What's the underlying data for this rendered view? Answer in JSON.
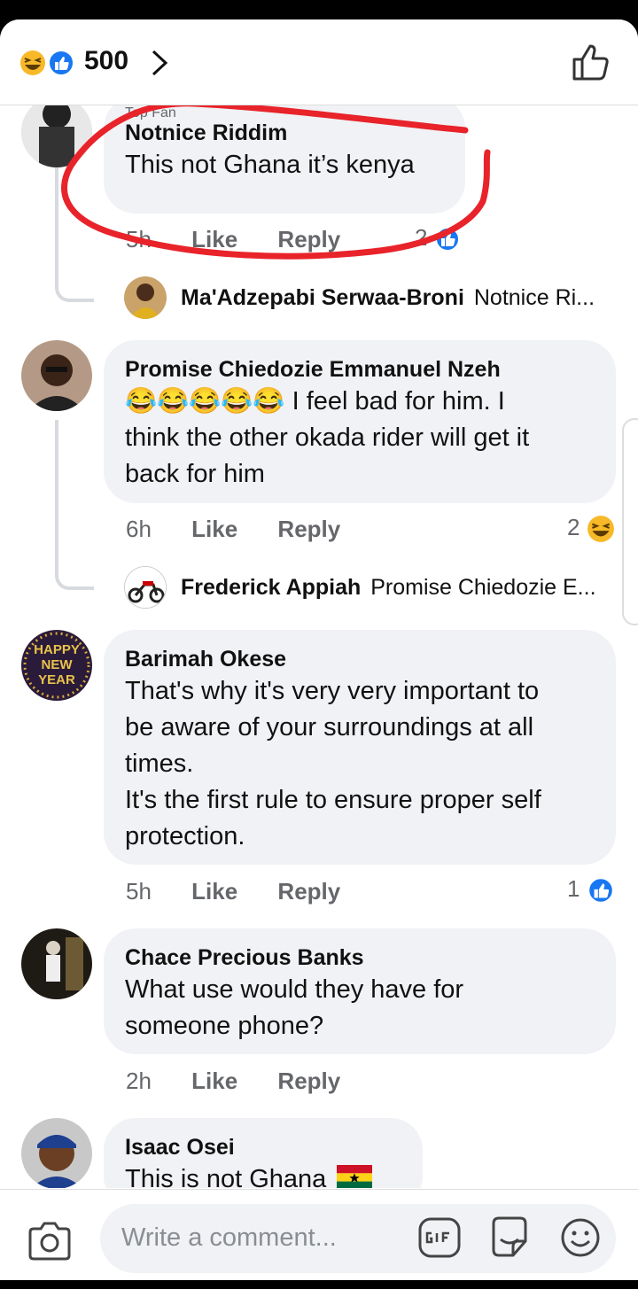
{
  "header": {
    "reaction_count": "500"
  },
  "comments": [
    {
      "label": "Top Fan",
      "name": "Notnice Riddim",
      "lines": [
        "This not Ghana it’s kenya"
      ],
      "time": "5h",
      "like": "Like",
      "reply": "Reply",
      "reactions": "2",
      "reply_preview": {
        "name": "Ma'Adzepabi Serwaa-Broni",
        "text": "Notnice Ri..."
      }
    },
    {
      "name": "Promise Chiedozie Emmanuel Nzeh",
      "emoji_prefix": "😂😂😂😂😂",
      "lines": [
        " I feel bad for him. I",
        "think the other okada rider will get it",
        "back for him"
      ],
      "time": "6h",
      "like": "Like",
      "reply": "Reply",
      "reactions": "2",
      "reply_preview": {
        "name": "Frederick Appiah",
        "text": "Promise Chiedozie E..."
      }
    },
    {
      "name": "Barimah Okese",
      "lines": [
        "That's why it's very very important to",
        "be aware of your surroundings at all",
        "times.",
        "It's the first rule to ensure proper self",
        "protection."
      ],
      "time": "5h",
      "like": "Like",
      "reply": "Reply",
      "reactions": "1",
      "avatar_text": "HAPPY NEW YEAR"
    },
    {
      "name": "Chace Precious Banks",
      "lines": [
        "What use would they have for",
        "someone phone?"
      ],
      "time": "2h",
      "like": "Like",
      "reply": "Reply"
    },
    {
      "name": "Isaac Osei",
      "lines": [
        "This is not Ghana"
      ]
    }
  ],
  "composer": {
    "placeholder": "Write a comment..."
  },
  "colors": {
    "facebook_blue": "#1877f2",
    "annotation_red": "#e8232a",
    "bubble_gray": "#f0f2f5"
  },
  "icons": [
    "haha-reaction-icon",
    "like-reaction-icon",
    "chevron-right-icon",
    "thumbs-up-outline-icon",
    "camera-icon",
    "gif-icon",
    "sticker-icon",
    "emoji-icon"
  ]
}
